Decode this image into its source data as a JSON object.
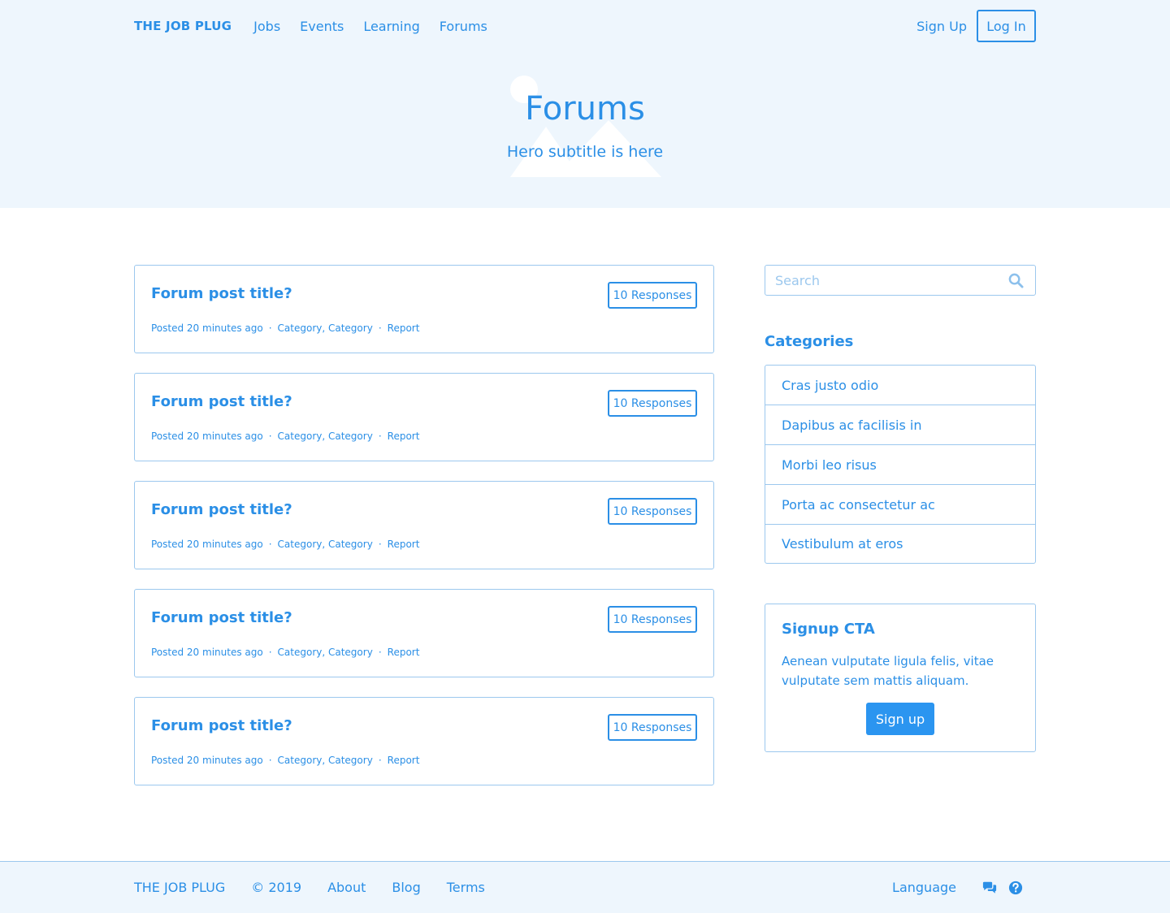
{
  "colors": {
    "accent": "#2b8fe6",
    "button_fill": "#2b95f0",
    "hero_bg": "#eef6fd",
    "border": "#9cc8ee"
  },
  "nav": {
    "brand": "THE JOB PLUG",
    "links": [
      "Jobs",
      "Events",
      "Learning",
      "Forums"
    ],
    "signup": "Sign Up",
    "login": "Log In"
  },
  "hero": {
    "title": "Forums",
    "subtitle": "Hero subtitle is here",
    "illustration_icon": "image-placeholder-icon"
  },
  "posts": [
    {
      "title": "Forum post title?",
      "responses": "10 Responses",
      "posted": "Posted 20 minutes ago",
      "categories": "Category, Category",
      "report": "Report"
    },
    {
      "title": "Forum post title?",
      "responses": "10 Responses",
      "posted": "Posted 20 minutes ago",
      "categories": "Category, Category",
      "report": "Report"
    },
    {
      "title": "Forum post title?",
      "responses": "10 Responses",
      "posted": "Posted 20 minutes ago",
      "categories": "Category, Category",
      "report": "Report"
    },
    {
      "title": "Forum post title?",
      "responses": "10 Responses",
      "posted": "Posted 20 minutes ago",
      "categories": "Category, Category",
      "report": "Report"
    },
    {
      "title": "Forum post title?",
      "responses": "10 Responses",
      "posted": "Posted 20 minutes ago",
      "categories": "Category, Category",
      "report": "Report"
    }
  ],
  "meta_separator": "·",
  "search": {
    "placeholder": "Search",
    "value": "",
    "icon": "search-icon"
  },
  "categories": {
    "heading": "Categories",
    "items": [
      "Cras justo odio",
      "Dapibus ac facilisis in",
      "Morbi leo risus",
      "Porta ac consectetur ac",
      "Vestibulum at eros"
    ]
  },
  "cta": {
    "title": "Signup CTA",
    "body": "Aenean vulputate ligula felis, vitae vulputate sem mattis aliquam.",
    "button": "Sign up"
  },
  "footer": {
    "brand": "THE JOB PLUG",
    "copyright": "© 2019",
    "links": [
      "About",
      "Blog",
      "Terms"
    ],
    "language": "Language",
    "icons": [
      "chat-icon",
      "help-icon"
    ]
  }
}
